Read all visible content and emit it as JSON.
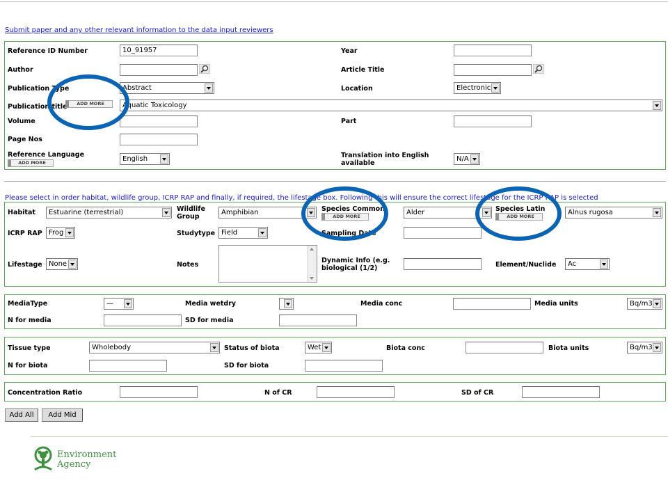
{
  "header": {
    "submit_link": "Submit paper and any other relevant information to the data input reviewers"
  },
  "reference": {
    "ref_id_label": "Reference ID Number",
    "ref_id_value": "10_91957",
    "year_label": "Year",
    "year_value": "",
    "author_label": "Author",
    "author_value": "",
    "article_title_label": "Article Title",
    "article_title_value": "",
    "pub_type_label": "Publication Type",
    "pub_type_value": "Abstract",
    "location_label": "Location",
    "location_value": "Electronic",
    "pub_title_label": "Publication title",
    "pub_title_value": "Aquatic Toxicology",
    "volume_label": "Volume",
    "volume_value": "",
    "part_label": "Part",
    "part_value": "",
    "page_nos_label": "Page Nos",
    "page_nos_value": "",
    "language_label": "Reference Language",
    "language_value": "English",
    "translation_label_1": "Translation into English",
    "translation_label_2": "available",
    "translation_value": "N/A",
    "add_more": "ADD MORE"
  },
  "instructions": "Please select in order habitat, wildlife group, ICRP RAP and finally, if required, the lifestage box. Following this will ensure the correct lifestage for the ICRP RAP is selected",
  "species": {
    "habitat_label": "Habitat",
    "habitat_value": "Estuarine (terrestrial)",
    "wildlife_label_1": "Wildlife",
    "wildlife_label_2": "Group",
    "wildlife_value": "Amphibian",
    "species_common_label": "Species Common",
    "species_common_value": "Alder",
    "species_latin_label": "Species Latin",
    "species_latin_value": "Alnus rugosa",
    "icrp_label": "ICRP RAP",
    "icrp_value": "Frog",
    "studytype_label": "Studytype",
    "studytype_value": "Field",
    "sampling_label": "Sampling Date",
    "sampling_value": "",
    "lifestage_label": "Lifestage",
    "lifestage_value": "None",
    "notes_label": "Notes",
    "notes_value": "",
    "dynamic_label_1": "Dynamic Info (e.g.",
    "dynamic_label_2": "biological (1/2)",
    "dynamic_value": "",
    "element_label": "Element/Nuclide",
    "element_value": "Ac",
    "add_more": "ADD MORE"
  },
  "media": {
    "type_label": "MediaType",
    "type_value": "—",
    "wetdry_label": "Media wetdry",
    "wetdry_value": "",
    "conc_label": "Media conc",
    "conc_value": "",
    "units_label": "Media units",
    "units_value": "Bq/m3",
    "n_label": "N for media",
    "n_value": "",
    "sd_label": "SD for media",
    "sd_value": ""
  },
  "biota": {
    "tissue_label": "Tissue type",
    "tissue_value": "Wholebody",
    "status_label": "Status of biota",
    "status_value": "Wet",
    "conc_label": "Biota conc",
    "conc_value": "",
    "units_label": "Biota units",
    "units_value": "Bq/m3",
    "n_label": "N for biota",
    "n_value": "",
    "sd_label": "SD for biota",
    "sd_value": ""
  },
  "cr": {
    "cr_label": "Concentration Ratio",
    "cr_value": "",
    "n_label": "N of CR",
    "n_value": "",
    "sd_label": "SD of CR",
    "sd_value": ""
  },
  "buttons": {
    "add_all": "Add All",
    "add_mid": "Add Mid"
  },
  "footer": {
    "logo_line1": "Environment",
    "logo_line2": "Agency"
  },
  "colors": {
    "section_border": "#5aa55a",
    "highlight_circle": "#0b63b3",
    "link": "#1a1acc",
    "logo_green": "#3e8f3e"
  }
}
